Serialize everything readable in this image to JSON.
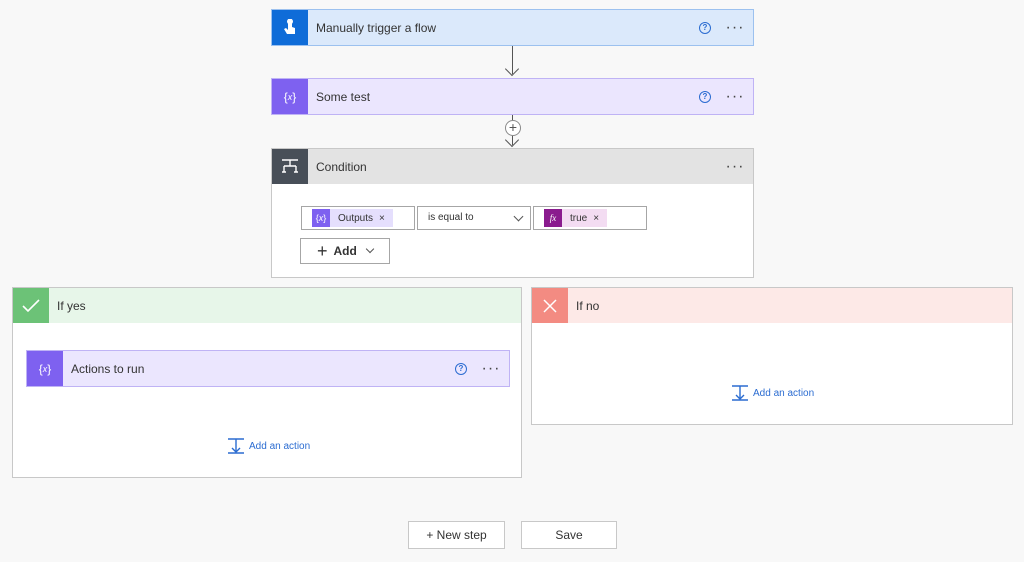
{
  "trigger": {
    "title": "Manually trigger a flow",
    "icon": "hand-touch-icon",
    "color": "#0f6cd8",
    "header_bg": "#dbe9fb"
  },
  "action1": {
    "title": "Some test",
    "icon": "variable-icon",
    "color": "#7e61f0",
    "header_bg": "#ebe6fe"
  },
  "condition": {
    "title": "Condition",
    "icon": "condition-icon",
    "color": "#484f58",
    "header_bg": "#e3e3e3",
    "left_token": "Outputs",
    "operator": "is equal to",
    "right_token": "true",
    "fx_color": "#8a1b8e",
    "add_label": "Add"
  },
  "branch_yes": {
    "title": "If yes",
    "color": "#6cc277",
    "header_bg": "#e7f6e9",
    "action_title": "Actions to run",
    "add_action_label": "Add an action"
  },
  "branch_no": {
    "title": "If no",
    "color": "#f38b82",
    "header_bg": "#fde9e7",
    "add_action_label": "Add an action"
  },
  "footer": {
    "new_step_label": "+ New step",
    "save_label": "Save"
  },
  "common": {
    "help_glyph": "?",
    "more_glyph": "···",
    "remove_glyph": "×",
    "fx_glyph": "fx",
    "plus_glyph": "+"
  }
}
